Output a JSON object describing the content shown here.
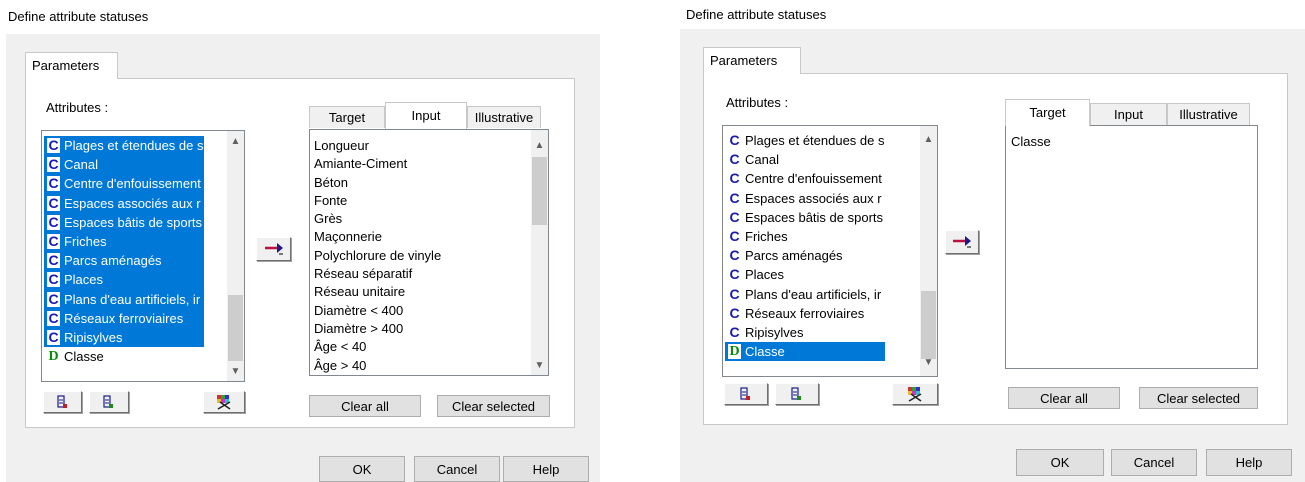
{
  "dialog_title": "Define attribute statuses",
  "parameters_tab": "Parameters",
  "attributes_label": "Attributes :",
  "right_tabs": [
    "Target",
    "Input",
    "Illustrative"
  ],
  "left_dialog": {
    "active_tab": "Input",
    "attributes": [
      {
        "icon": "C",
        "label": "Plages et étendues de s",
        "selected": true
      },
      {
        "icon": "C",
        "label": "Canal",
        "selected": true
      },
      {
        "icon": "C",
        "label": "Centre d'enfouissement",
        "selected": true
      },
      {
        "icon": "C",
        "label": "Espaces associés aux r",
        "selected": true
      },
      {
        "icon": "C",
        "label": "Espaces bâtis de sports",
        "selected": true
      },
      {
        "icon": "C",
        "label": "Friches",
        "selected": true
      },
      {
        "icon": "C",
        "label": "Parcs aménagés",
        "selected": true
      },
      {
        "icon": "C",
        "label": "Places",
        "selected": true
      },
      {
        "icon": "C",
        "label": "Plans d'eau artificiels, ir",
        "selected": true
      },
      {
        "icon": "C",
        "label": "Réseaux ferroviaires",
        "selected": true
      },
      {
        "icon": "C",
        "label": "Ripisylves",
        "selected": true
      },
      {
        "icon": "D",
        "label": "Classe",
        "selected": false
      }
    ],
    "input_items": [
      "Longueur",
      "Amiante-Ciment",
      "Béton",
      "Fonte",
      "Grès",
      "Maçonnerie",
      "Polychlorure de vinyle",
      "Réseau séparatif",
      "Réseau unitaire",
      "Diamètre < 400",
      "Diamètre > 400",
      "Âge < 40",
      "Âge > 40"
    ]
  },
  "right_dialog": {
    "active_tab": "Target",
    "attributes": [
      {
        "icon": "C",
        "label": "Plages et étendues de s",
        "selected": false
      },
      {
        "icon": "C",
        "label": "Canal",
        "selected": false
      },
      {
        "icon": "C",
        "label": "Centre d'enfouissement",
        "selected": false
      },
      {
        "icon": "C",
        "label": "Espaces associés aux r",
        "selected": false
      },
      {
        "icon": "C",
        "label": "Espaces bâtis de sports",
        "selected": false
      },
      {
        "icon": "C",
        "label": "Friches",
        "selected": false
      },
      {
        "icon": "C",
        "label": "Parcs aménagés",
        "selected": false
      },
      {
        "icon": "C",
        "label": "Places",
        "selected": false
      },
      {
        "icon": "C",
        "label": "Plans d'eau artificiels, ir",
        "selected": false
      },
      {
        "icon": "C",
        "label": "Réseaux ferroviaires",
        "selected": false
      },
      {
        "icon": "C",
        "label": "Ripisylves",
        "selected": false
      },
      {
        "icon": "D",
        "label": "Classe",
        "selected": true
      }
    ],
    "target_items": [
      "Classe"
    ]
  },
  "buttons": {
    "clear_all": "Clear all",
    "clear_selected": "Clear selected",
    "ok": "OK",
    "cancel": "Cancel",
    "help": "Help"
  },
  "icons": {
    "move_arrow": "move-right-arrow-icon",
    "list_icon_1": "list-format-icon",
    "list_icon_2": "list-add-icon",
    "palette": "palette-icon"
  },
  "colors": {
    "selection": "#0078d7",
    "continuous_icon": "#1919b4",
    "discrete_icon": "#0a8a0a",
    "dialog_bg": "#f0f0f0"
  }
}
